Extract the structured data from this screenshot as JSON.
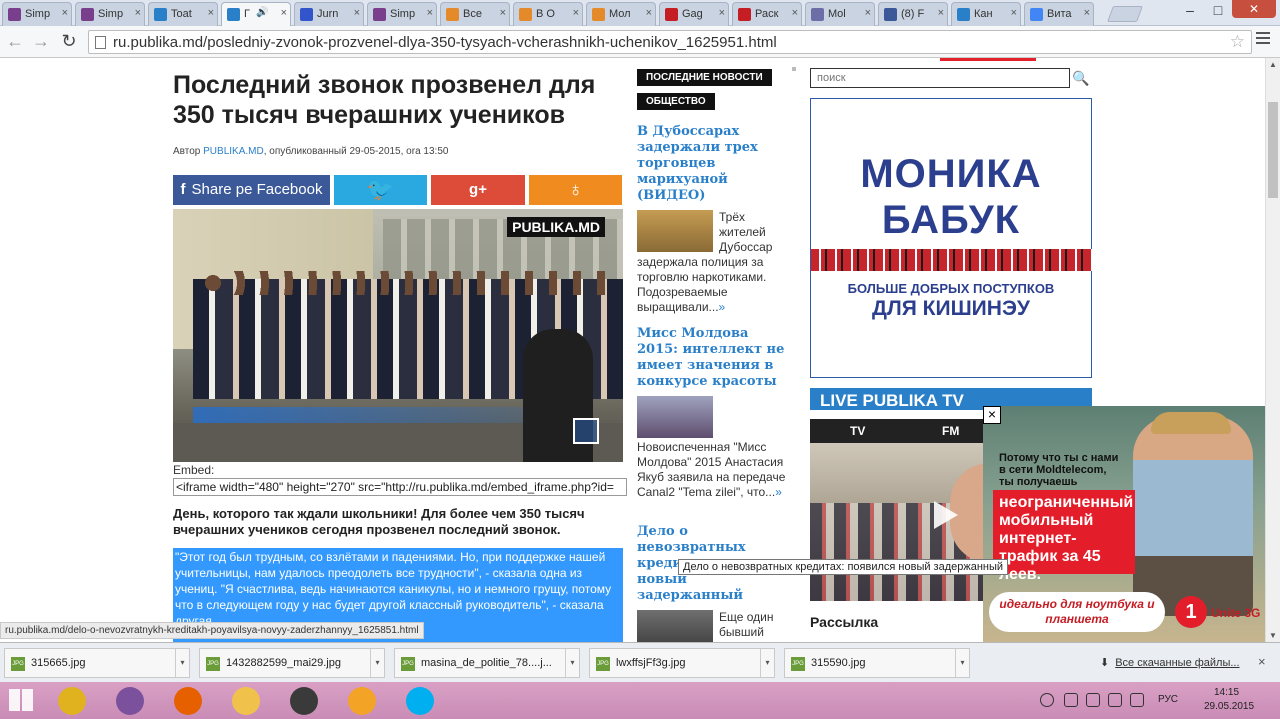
{
  "browser": {
    "tabs": [
      {
        "label": "Simp",
        "color": "#7a3f8c",
        "active": false
      },
      {
        "label": "Simp",
        "color": "#7a3f8c",
        "active": false
      },
      {
        "label": "Toat",
        "color": "#2a7fc9",
        "active": false
      },
      {
        "label": "Г",
        "color": "#2a7fc9",
        "active": true
      },
      {
        "label": "Jurn",
        "color": "#3355cc",
        "active": false
      },
      {
        "label": "Simp",
        "color": "#7a3f8c",
        "active": false
      },
      {
        "label": "Все",
        "color": "#e58a2a",
        "active": false
      },
      {
        "label": "В О",
        "color": "#e58a2a",
        "active": false
      },
      {
        "label": "Мол",
        "color": "#e58a2a",
        "active": false
      },
      {
        "label": "Gag",
        "color": "#c41d24",
        "active": false
      },
      {
        "label": "Раск",
        "color": "#c41d24",
        "active": false
      },
      {
        "label": "Mol",
        "color": "#6d6da8",
        "active": false
      },
      {
        "label": "(8) F",
        "color": "#3b5998",
        "active": false
      },
      {
        "label": "Кан",
        "color": "#2a7fc9",
        "active": false
      },
      {
        "label": "Вита",
        "color": "#4285f4",
        "active": false
      }
    ],
    "url": "ru.publika.md/posledniy-zvonok-prozvenel-dlya-350-tysyach-vcherashnikh-uchenikov_1625951.html",
    "status_url": "ru.publika.md/delo-o-nevozvratnykh-kreditakh-poyavilsya-novyy-zaderzhannyy_1625851.html"
  },
  "article": {
    "title": "Последний звонок прозвенел для 350 тысяч вчерашних учеников",
    "byline_prefix": "Автор",
    "author": "PUBLIKA.MD",
    "byline_suffix": ", опубликованный 29-05-2015, ora 13:50",
    "share": {
      "facebook": "Share pe Facebook",
      "twitter_icon": "twitter-bird",
      "gplus": "g+",
      "ok": "ok"
    },
    "video_logo": "PUBLIKA.MD",
    "embed_label": "Embed:",
    "embed_code": "<iframe width=\"480\" height=\"270\" src=\"http://ru.publika.md/embed_iframe.php?id=",
    "lead": "День, которого так ждали школьники! Для более чем 350 тысяч вчерашних учеников сегодня прозвенел последний звонок.",
    "quote": "\"Этот год был трудным, со взлётами и падениями. Но, при поддержке нашей учительницы, нам удалось преодолеть все трудности\", - сказала одна из учениц. \"Я счастлива, ведь начинаются каникулы, но и немного грущу, потому что в следующем году у нас будет другой классный руководитель\", - сказала другая."
  },
  "sidebar_mid": {
    "badge_latest": "ПОСЛЕДНИЕ НОВОСТИ",
    "badge_society": "ОБЩЕСТВО",
    "news": [
      {
        "title": "В Дубоссарах задержали трех торговцев марихуаной (ВИДЕО)",
        "text": "Трёх жителей Дубоссар задержала полиция за торговлю наркотиками. Подозреваемые выращивали...",
        "more": "»"
      },
      {
        "title": "Мисс Молдова 2015: интеллект не имеет значения в конкурсе красоты",
        "text": "Новоиспеченная \"Мисс Молдова\" 2015 Анастасия Якуб заявила на передаче Canal2 \"Tema zilei\", что...",
        "more": "»"
      },
      {
        "title": "Дело о невозвратных кредитах: появился новый задержанный",
        "text": "Еще один бывший член комитета по кредитованию Banca de Economii",
        "more": ""
      }
    ],
    "tooltip": "Дело о невозвратных кредитах: появился новый задержанный"
  },
  "sidebar_right": {
    "search_placeholder": "поиск",
    "banner": {
      "line1": "МОНИКА",
      "line2": "БАБУК",
      "sub1": "БОЛЬШЕ ДОБРЫХ ПОСТУПКОВ",
      "sub2": "ДЛЯ КИШИНЭУ"
    },
    "live_title": "LIVE PUBLIKA TV",
    "tab_tv": "TV",
    "tab_fm": "FM",
    "newsletter": "Рассылка"
  },
  "ad": {
    "text1": "Потому что ты с нами в сети Moldtelecom, ты получаешь",
    "red": "неограниченный мобильный интернет-трафик за 45 леев.",
    "pill": "идеально для ноутбука и планшета",
    "logo_mark": "1",
    "logo_text": "Unite 3G",
    "close": "×"
  },
  "downloads": {
    "items": [
      "315665.jpg",
      "1432882599_mai29.jpg",
      "masina_de_politie_78....j...",
      "lwxffsjFf3g.jpg",
      "315590.jpg"
    ],
    "file_type": "JPG",
    "show_all": "Все скачанные файлы...",
    "close": "×"
  },
  "taskbar": {
    "lang": "РУС",
    "time": "14:15",
    "date": "29.05.2015",
    "apps": [
      {
        "name": "chrome",
        "color": "#e0b21f"
      },
      {
        "name": "viber",
        "color": "#7b519d"
      },
      {
        "name": "firefox",
        "color": "#e66000"
      },
      {
        "name": "explorer",
        "color": "#f1c24b"
      },
      {
        "name": "camera",
        "color": "#3a3a3a"
      },
      {
        "name": "chat",
        "color": "#f3a326"
      },
      {
        "name": "skype",
        "color": "#00aff0"
      }
    ]
  },
  "colors": {
    "link": "#2a7fc9",
    "selection": "#3399ff",
    "taskbar": "#d9a0c4",
    "publika_red": "#e4202b"
  }
}
